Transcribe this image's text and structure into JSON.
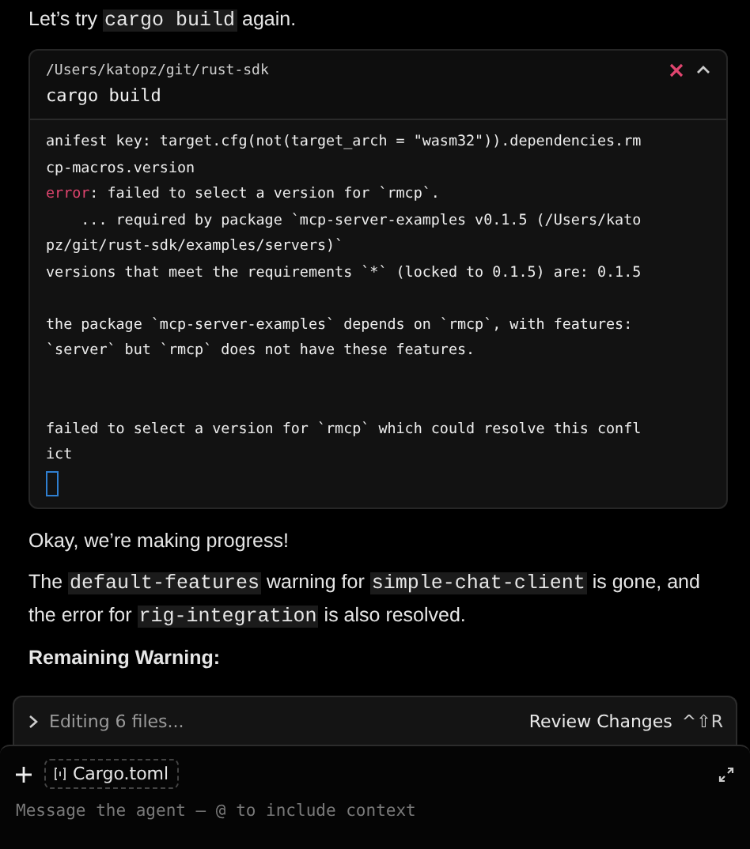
{
  "intro": {
    "before": "Let’s try",
    "code": "cargo build",
    "after": "again."
  },
  "terminal": {
    "cwd": "/Users/katopz/git/rust-sdk",
    "command": "cargo build",
    "lines": [
      {
        "kind": "plain",
        "text": "anifest key: target.cfg(not(target_arch = \"wasm32\")).dependencies.rm"
      },
      {
        "kind": "plain",
        "text": "cp-macros.version"
      },
      {
        "kind": "error",
        "label": "error",
        "text": ": failed to select a version for `rmcp`."
      },
      {
        "kind": "plain",
        "text": "    ... required by package `mcp-server-examples v0.1.5 (/Users/kato"
      },
      {
        "kind": "plain",
        "text": "pz/git/rust-sdk/examples/servers)`"
      },
      {
        "kind": "plain",
        "text": "versions that meet the requirements `*` (locked to 0.1.5) are: 0.1.5"
      },
      {
        "kind": "blank"
      },
      {
        "kind": "plain",
        "text": "the package `mcp-server-examples` depends on `rmcp`, with features:"
      },
      {
        "kind": "plain",
        "text": "`server` but `rmcp` does not have these features."
      },
      {
        "kind": "blank"
      },
      {
        "kind": "blank"
      },
      {
        "kind": "plain",
        "text": "failed to select a version for `rmcp` which could resolve this confl"
      },
      {
        "kind": "plain",
        "text": "ict"
      },
      {
        "kind": "cursor"
      }
    ]
  },
  "paragraphs": [
    {
      "kind": "text",
      "parts": [
        {
          "code": false,
          "text": "Okay, we’re making progress!"
        }
      ]
    },
    {
      "kind": "text",
      "parts": [
        {
          "code": false,
          "text": "The "
        },
        {
          "code": true,
          "text": "default-features"
        },
        {
          "code": false,
          "text": " warning for "
        },
        {
          "code": true,
          "text": "simple-chat-client"
        },
        {
          "code": false,
          "text": " is gone, and the error for "
        },
        {
          "code": true,
          "text": "rig-integration"
        },
        {
          "code": false,
          "text": " is also resolved."
        }
      ]
    },
    {
      "kind": "heading",
      "parts": [
        {
          "code": false,
          "text": "Remaining Warning:"
        }
      ]
    }
  ],
  "status_bar": {
    "label": "Editing 6 files...",
    "action": "Review Changes",
    "shortcut": "^⇧R"
  },
  "composer": {
    "attachment": "Cargo.toml",
    "placeholder": "Message the agent — @ to include context"
  }
}
